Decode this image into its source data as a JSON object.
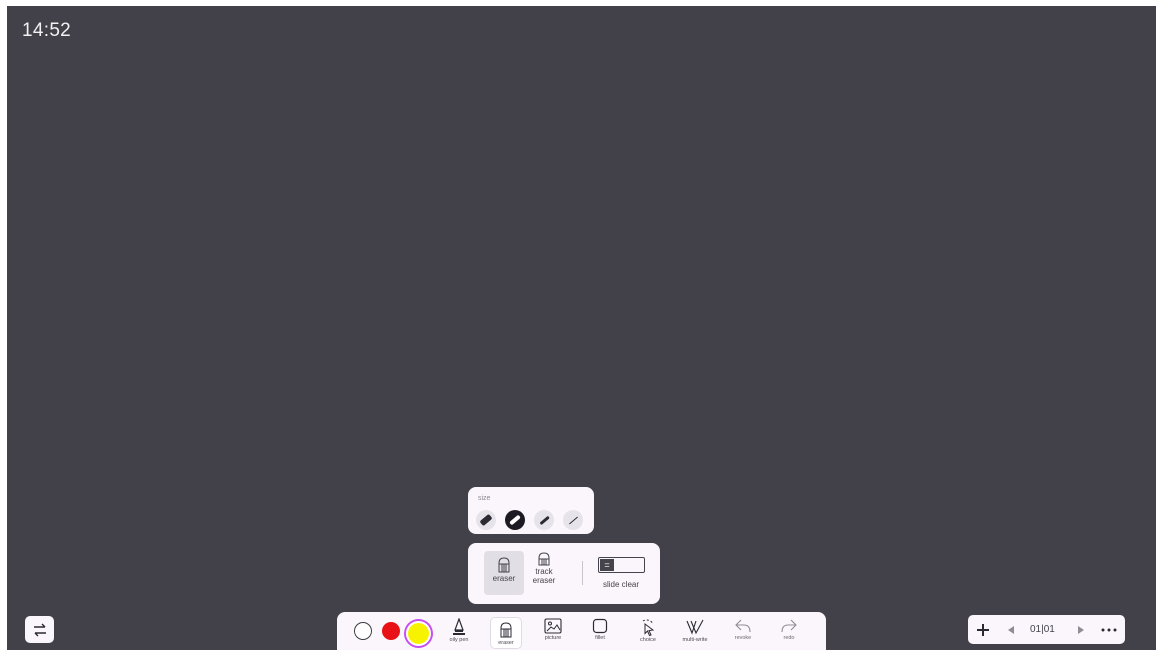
{
  "clock": {
    "time": "14:52"
  },
  "size_panel": {
    "label": "size",
    "options": [
      {
        "name": "size-xl",
        "selected": false
      },
      {
        "name": "size-l",
        "selected": true
      },
      {
        "name": "size-m",
        "selected": false
      },
      {
        "name": "size-s",
        "selected": false
      }
    ]
  },
  "eraser_panel": {
    "eraser_label": "eraser",
    "track_eraser_label_line1": "track",
    "track_eraser_label_line2": "eraser",
    "slide_clear_label": "slide clear"
  },
  "toolbar": {
    "colors": {
      "white": "#ffffff",
      "red": "#e81216",
      "yellow": "#f7f300"
    },
    "oily_pen_label": "oily pen",
    "eraser_label": "eraser",
    "picture_label": "picture",
    "fillet_label": "fillet",
    "choice_label": "choice",
    "multi_write_label": "multi-write",
    "revoke_label": "revoke",
    "redo_label": "redo"
  },
  "pager": {
    "page_display": "01|01"
  },
  "icons": {
    "switch": "swap-arrows-icon",
    "add": "plus-icon",
    "prev": "triangle-left-icon",
    "next": "triangle-right-icon",
    "more": "more-dots-icon"
  },
  "theme": {
    "board_bg": "#42414a",
    "panel_bg": "#fbf6fb",
    "accent_dark": "#1c1b23"
  }
}
